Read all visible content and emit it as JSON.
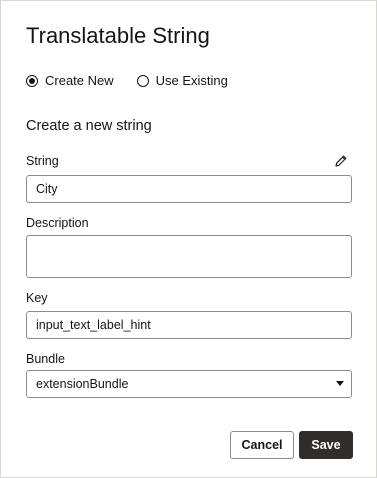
{
  "dialog": {
    "title": "Translatable String",
    "mode_options": [
      {
        "label": "Create New",
        "selected": true
      },
      {
        "label": "Use Existing",
        "selected": false
      }
    ],
    "section_heading": "Create a new string",
    "fields": {
      "string": {
        "label": "String",
        "value": "City",
        "edit_icon": "pencil-icon"
      },
      "description": {
        "label": "Description",
        "value": ""
      },
      "key": {
        "label": "Key",
        "value": "input_text_label_hint"
      },
      "bundle": {
        "label": "Bundle",
        "selected": "extensionBundle",
        "caret_icon": "caret-down-icon"
      }
    },
    "buttons": {
      "cancel": "Cancel",
      "save": "Save"
    }
  },
  "colors": {
    "text": "#161513",
    "border": "#8e8c8a",
    "primary_button": "#312d2a"
  }
}
